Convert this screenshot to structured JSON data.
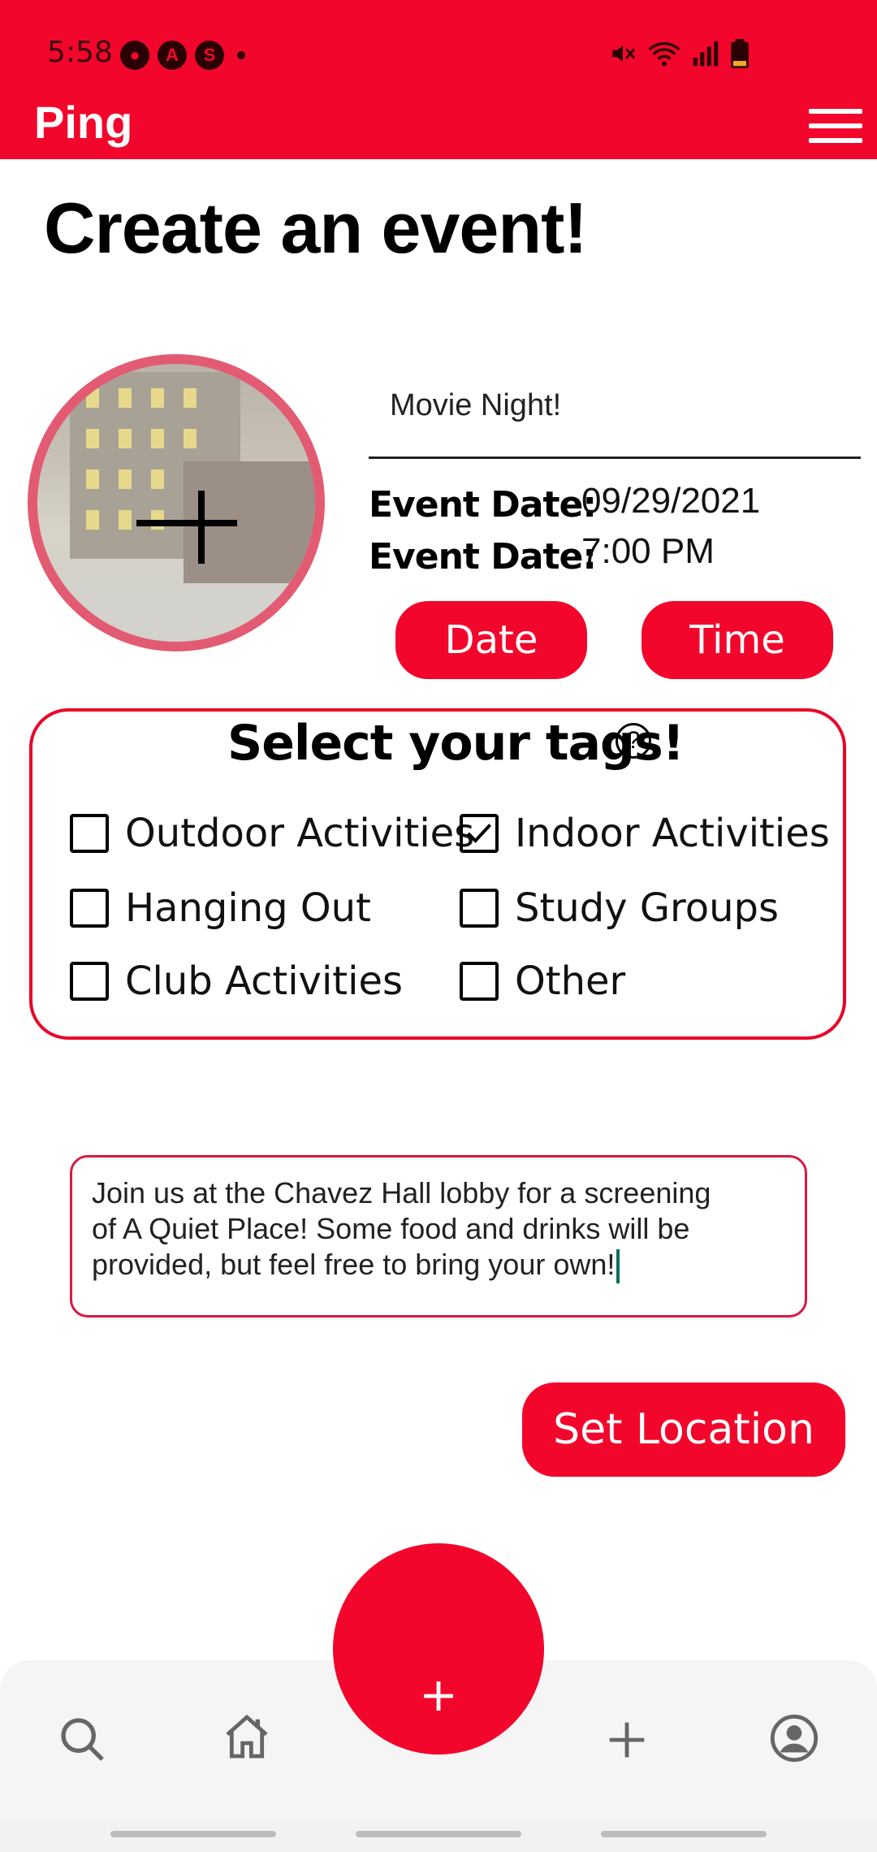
{
  "status_bar": {
    "time": "5:58",
    "icons": [
      "snapchat-icon",
      "a-app-icon",
      "s-app-icon",
      "notification-dot",
      "mute-icon",
      "wifi-icon",
      "signal-icon",
      "battery-icon"
    ]
  },
  "app_bar": {
    "title": "Ping",
    "menu_icon": "hamburger-menu-icon"
  },
  "page": {
    "title": "Create an event!"
  },
  "event": {
    "name": "Movie Night!",
    "date_label": "Event Date:",
    "date_value": "09/29/2021",
    "time_label": "Event Date:",
    "time_value": "7:00 PM",
    "date_button": "Date",
    "time_button": "Time",
    "photo_icon": "add-photo-plus-icon"
  },
  "tags": {
    "title": "Select your tags!",
    "help_icon": "help-circle-icon",
    "items": [
      {
        "label": "Outdoor Activities",
        "checked": false
      },
      {
        "label": "Indoor Activities",
        "checked": true
      },
      {
        "label": "Hanging Out",
        "checked": false
      },
      {
        "label": "Study Groups",
        "checked": false
      },
      {
        "label": "Club Activities",
        "checked": false
      },
      {
        "label": "Other",
        "checked": false
      }
    ]
  },
  "description": {
    "line1": "Join us at the Chavez Hall lobby for a screening",
    "line2": "of A Quiet Place! Some food and drinks will be",
    "line3": "provided, but feel free to bring your own!"
  },
  "actions": {
    "set_location": "Set Location"
  },
  "bottom_nav": {
    "items": [
      "search-icon",
      "home-icon",
      "create-event-fab-plus-icon",
      "add-icon",
      "profile-icon"
    ]
  },
  "colors": {
    "brand_red": "#f2062b",
    "card_border": "#e8062b",
    "text_field_border": "#d81945"
  }
}
